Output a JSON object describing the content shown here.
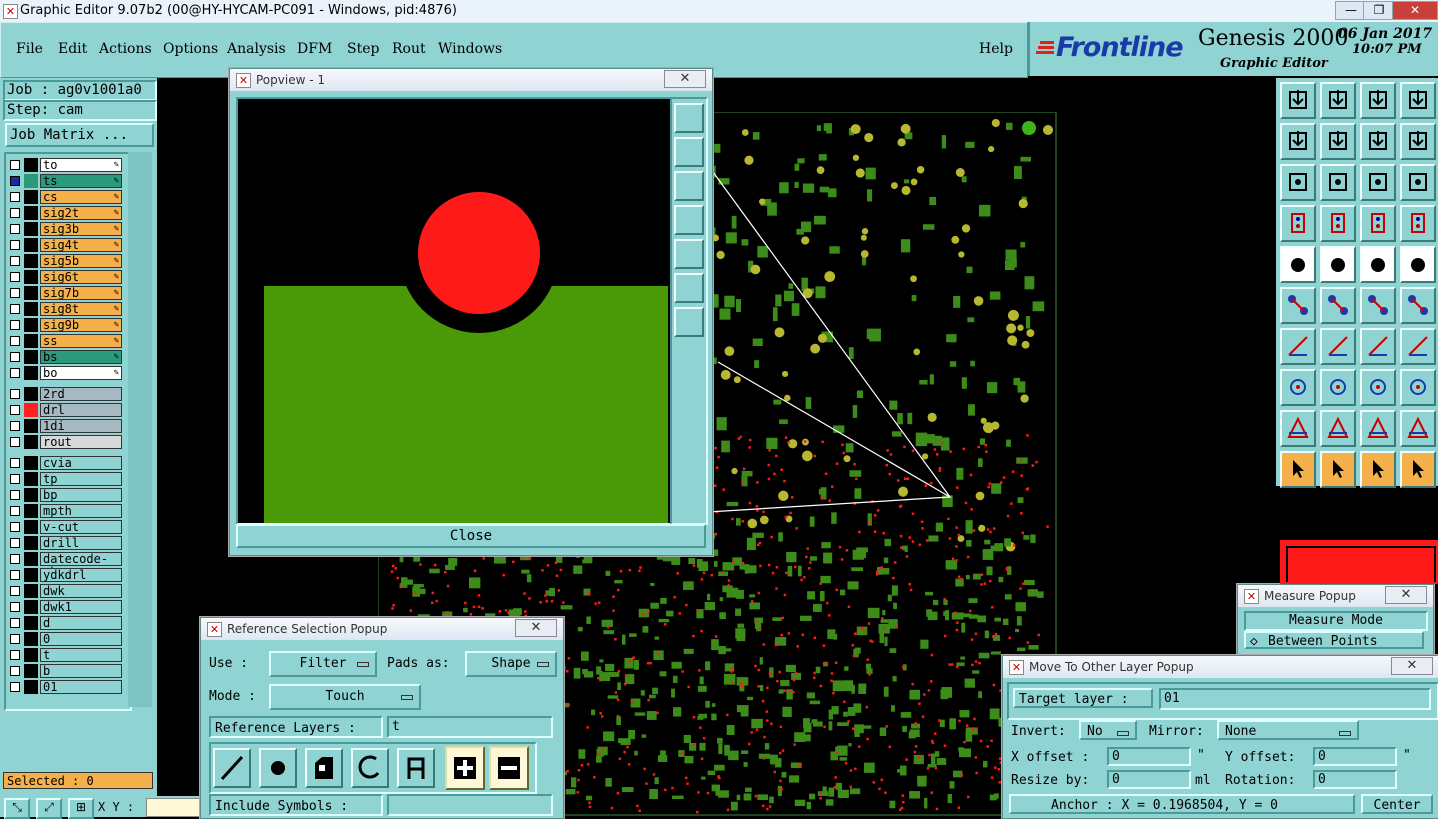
{
  "window": {
    "title": "Graphic Editor 9.07b2 (00@HY-HYCAM-PC091 - Windows, pid:4876)",
    "min_label": "—",
    "max_label": "❐",
    "close_label": "✕"
  },
  "menubar": {
    "items": [
      "File",
      "Edit",
      "Actions",
      "Options",
      "Analysis",
      "DFM",
      "Step",
      "Rout",
      "Windows"
    ],
    "help": "Help"
  },
  "branding": {
    "logo": "Frontline",
    "product": "Genesis 2000",
    "subtitle": "Graphic Editor",
    "date": "06 Jan 2017",
    "time": "10:07 PM"
  },
  "job": {
    "job_label": "Job : ag0v1001a0",
    "step_label": "Step: cam",
    "matrix_button": "Job Matrix ...",
    "selected": "Selected : 0",
    "xy_label": "X Y :"
  },
  "layers_group1": [
    {
      "name": "to",
      "color": "#ffffff"
    },
    {
      "name": "ts",
      "color": "#2a9a7a",
      "active": true
    },
    {
      "name": "cs",
      "color": "#f4b04a"
    },
    {
      "name": "sig2t",
      "color": "#f4b04a"
    },
    {
      "name": "sig3b",
      "color": "#f4b04a"
    },
    {
      "name": "sig4t",
      "color": "#f4b04a"
    },
    {
      "name": "sig5b",
      "color": "#f4b04a"
    },
    {
      "name": "sig6t",
      "color": "#f4b04a"
    },
    {
      "name": "sig7b",
      "color": "#f4b04a"
    },
    {
      "name": "sig8t",
      "color": "#f4b04a"
    },
    {
      "name": "sig9b",
      "color": "#f4b04a"
    },
    {
      "name": "ss",
      "color": "#f4b04a"
    },
    {
      "name": "bs",
      "color": "#2a9a7a"
    },
    {
      "name": "bo",
      "color": "#ffffff"
    }
  ],
  "layers_group2": [
    {
      "name": "2rd",
      "color": "#a7b8c2"
    },
    {
      "name": "drl",
      "color": "#a7b8c2",
      "swatch": "#ff2020"
    },
    {
      "name": "1di",
      "color": "#a7b8c2"
    },
    {
      "name": "rout",
      "color": "#d8d8d8"
    }
  ],
  "layers_group3": [
    {
      "name": "cvia"
    },
    {
      "name": "tp"
    },
    {
      "name": "bp"
    },
    {
      "name": "mpth"
    },
    {
      "name": "v-cut"
    },
    {
      "name": "drill"
    },
    {
      "name": "datecode-pbe"
    },
    {
      "name": "ydkdrl"
    },
    {
      "name": "dwk"
    },
    {
      "name": "dwk1"
    },
    {
      "name": "d"
    },
    {
      "name": "0"
    },
    {
      "name": "t"
    },
    {
      "name": "b"
    },
    {
      "name": "01"
    }
  ],
  "popview": {
    "title": "Popview - 1",
    "close_button": "Close"
  },
  "refsel": {
    "title": "Reference Selection Popup",
    "use_label": "Use  :",
    "use_value": "Filter",
    "pads_label": "Pads as:",
    "pads_value": "Shape",
    "mode_label": "Mode :",
    "mode_value": "Touch",
    "ref_layers_label": "Reference Layers :",
    "ref_layers_value": "t",
    "include_label": "Include Symbols :",
    "include_value": ""
  },
  "measure": {
    "title": "Measure Popup",
    "mode_label": "Measure Mode",
    "mode_value": "Between Points"
  },
  "movelayer": {
    "title": "Move To Other Layer Popup",
    "target_label": "Target layer :",
    "target_value": "01",
    "invert_label": "Invert:",
    "invert_value": "No",
    "mirror_label": "Mirror:",
    "mirror_value": "None",
    "xoff_label": "X offset :",
    "xoff_value": "0",
    "yoff_label": "Y offset:",
    "yoff_value": "0",
    "unit_mark": "\"",
    "resize_label": "Resize by:",
    "resize_value": "0",
    "resize_unit": "ml",
    "rotation_label": "Rotation:",
    "rotation_value": "0",
    "anchor_text": "Anchor :   X = 0.1968504, Y = 0",
    "center_button": "Center"
  },
  "colors": {
    "panel": "#8fd3d3",
    "signal_layer": "#f4b04a",
    "mask_layer": "#2a9a7a",
    "pcb_green": "#3d8c1a",
    "pad_red": "#ff1a1a",
    "drill_yellow": "#b8b830"
  }
}
